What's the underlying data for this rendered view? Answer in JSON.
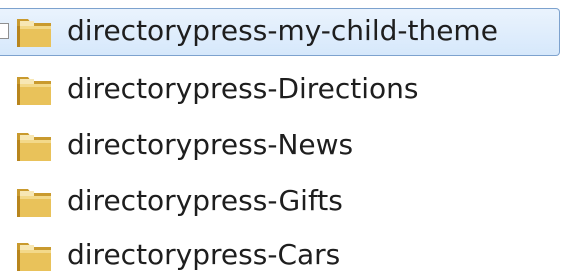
{
  "file_list": {
    "items": [
      {
        "name": "directorypress-my-child-theme",
        "selected": true
      },
      {
        "name": "directorypress-Directions",
        "selected": false
      },
      {
        "name": "directorypress-News",
        "selected": false
      },
      {
        "name": "directorypress-Gifts",
        "selected": false
      },
      {
        "name": "directorypress-Cars",
        "selected": false
      }
    ]
  },
  "icons": {
    "folder": "folder-icon",
    "checkbox": "checkbox-icon"
  },
  "colors": {
    "selection_border": "#7da2ce",
    "selection_fill_top": "#eaf3fd",
    "selection_fill_bottom": "#d6e8fb",
    "folder_yellow": "#e9c25a",
    "folder_dark": "#c99a2e",
    "text": "#1e1e1e"
  }
}
